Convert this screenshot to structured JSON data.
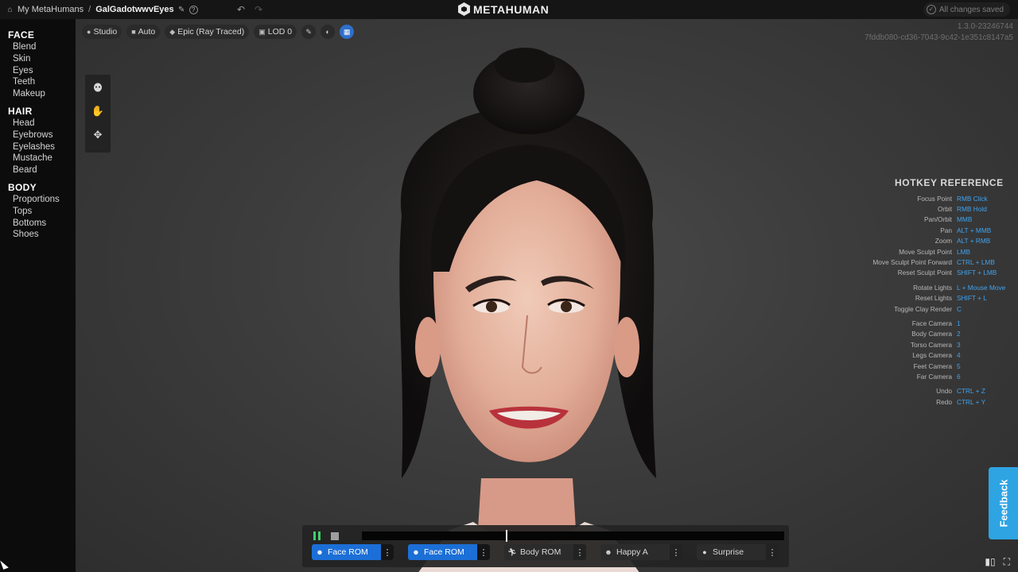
{
  "topbar": {
    "breadcrumb_root": "My MetaHumans",
    "breadcrumb_sep": "/",
    "breadcrumb_current": "GalGadotwwvEyes",
    "logo_text": "METAHUMAN",
    "saved_status": "All changes saved"
  },
  "sidebar": {
    "sections": [
      {
        "title": "FACE",
        "items": [
          "Blend",
          "Skin",
          "Eyes",
          "Teeth",
          "Makeup"
        ]
      },
      {
        "title": "HAIR",
        "items": [
          "Head",
          "Eyebrows",
          "Eyelashes",
          "Mustache",
          "Beard"
        ]
      },
      {
        "title": "BODY",
        "items": [
          "Proportions",
          "Tops",
          "Bottoms",
          "Shoes"
        ]
      }
    ]
  },
  "toolbar": {
    "lighting": "Studio",
    "camera": "Auto",
    "quality": "Epic (Ray Traced)",
    "lod": "LOD 0"
  },
  "version": {
    "build": "1.3.0-23246744",
    "guid": "7fddb080-cd36-7043-9c42-1e351c8147a5"
  },
  "hotkeys": {
    "title": "HOTKEY REFERENCE",
    "groups": [
      [
        {
          "label": "Focus Point",
          "key": "RMB Click"
        },
        {
          "label": "Orbit",
          "key": "RMB Hold"
        },
        {
          "label": "Pan/Orbit",
          "key": "MMB"
        },
        {
          "label": "Pan",
          "key": "ALT + MMB"
        },
        {
          "label": "Zoom",
          "key": "ALT + RMB"
        },
        {
          "label": "Move Sculpt Point",
          "key": "LMB"
        },
        {
          "label": "Move Sculpt Point Forward",
          "key": "CTRL + LMB"
        },
        {
          "label": "Reset Sculpt Point",
          "key": "SHIFT + LMB"
        }
      ],
      [
        {
          "label": "Rotate Lights",
          "key": "L + Mouse Move"
        },
        {
          "label": "Reset Lights",
          "key": "SHIFT + L"
        },
        {
          "label": "Toggle Clay Render",
          "key": "C"
        }
      ],
      [
        {
          "label": "Face Camera",
          "key": "1"
        },
        {
          "label": "Body Camera",
          "key": "2"
        },
        {
          "label": "Torso Camera",
          "key": "3"
        },
        {
          "label": "Legs Camera",
          "key": "4"
        },
        {
          "label": "Feet Camera",
          "key": "5"
        },
        {
          "label": "Far Camera",
          "key": "6"
        }
      ],
      [
        {
          "label": "Undo",
          "key": "CTRL + Z"
        },
        {
          "label": "Redo",
          "key": "CTRL + Y"
        }
      ]
    ]
  },
  "feedback_label": "Feedback",
  "animation": {
    "playhead_fraction": 0.34,
    "clips": [
      {
        "label": "Face ROM",
        "icon": "face-icon",
        "active": true
      },
      {
        "label": "Face ROM",
        "icon": "face-icon",
        "active": true
      },
      {
        "label": "Body ROM",
        "icon": "running-icon",
        "active": false
      },
      {
        "label": "Happy A",
        "icon": "face-icon",
        "active": false
      },
      {
        "label": "Surprise",
        "icon": "head-icon",
        "active": false
      }
    ]
  }
}
